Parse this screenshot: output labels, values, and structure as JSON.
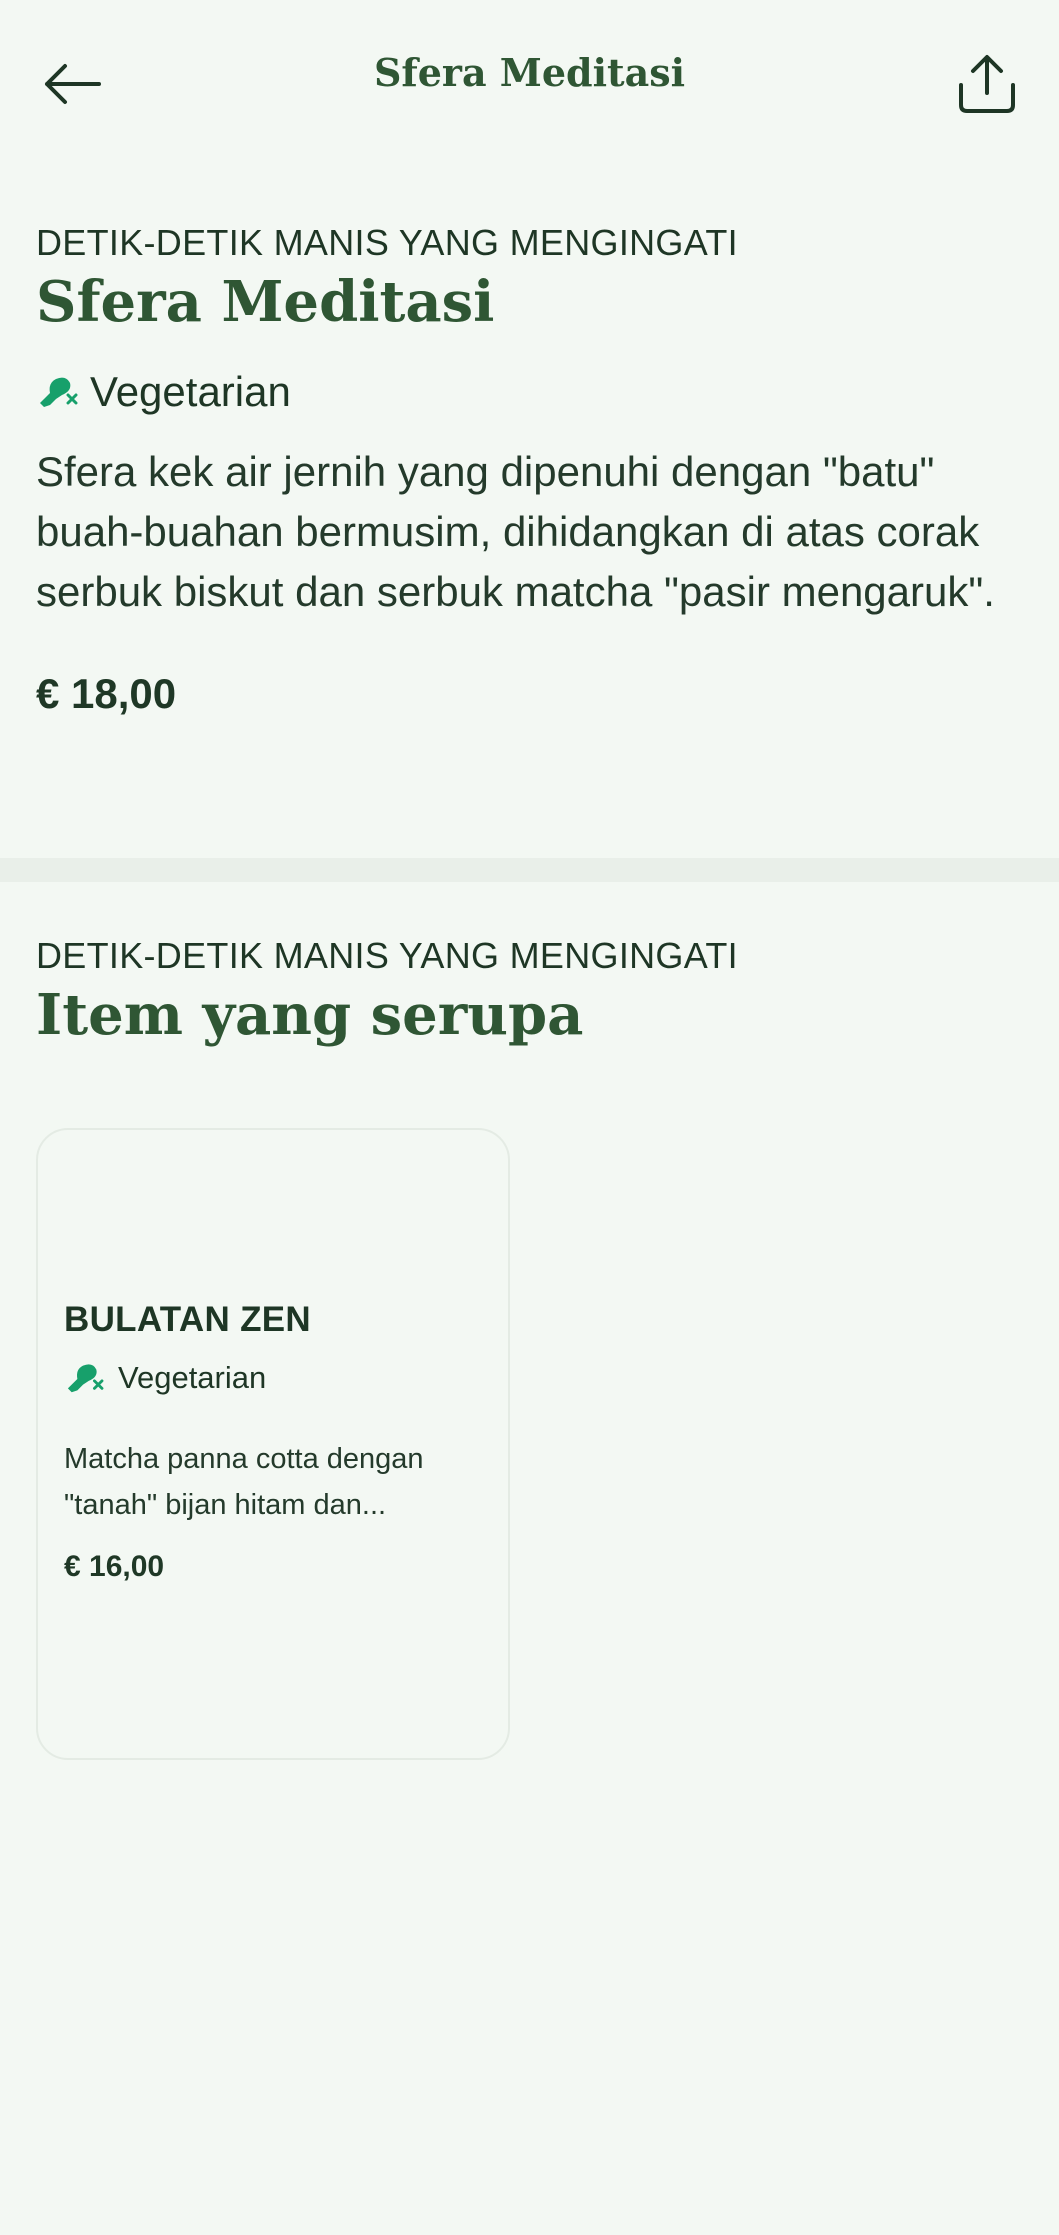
{
  "header": {
    "title": "Sfera Meditasi",
    "back_icon": "arrow-left-icon",
    "share_icon": "share-icon"
  },
  "product": {
    "category": "DETIK-DETIK MANIS YANG MENGINGATI",
    "name": "Sfera Meditasi",
    "tag_icon": "vegetarian-drumstick-icon",
    "tag": "Vegetarian",
    "description": "Sfera kek air jernih yang dipenuhi dengan \"batu\" buah-buahan bermusim, dihidangkan di atas corak serbuk biskut dan serbuk matcha \"pasir mengaruk\".",
    "price": "€ 18,00"
  },
  "similar": {
    "category": "DETIK-DETIK MANIS YANG MENGINGATI",
    "title": "Item yang serupa",
    "items": [
      {
        "name": "BULATAN ZEN",
        "tag": "Vegetarian",
        "tag_icon": "vegetarian-drumstick-icon",
        "description": "Matcha panna cotta dengan \"tanah\" bijan hitam dan...",
        "price": "€ 16,00"
      }
    ]
  },
  "colors": {
    "background": "#f3f8f3",
    "accent_green": "#2f5634",
    "tag_green": "#17a06b",
    "text_dark": "#1e3625"
  }
}
